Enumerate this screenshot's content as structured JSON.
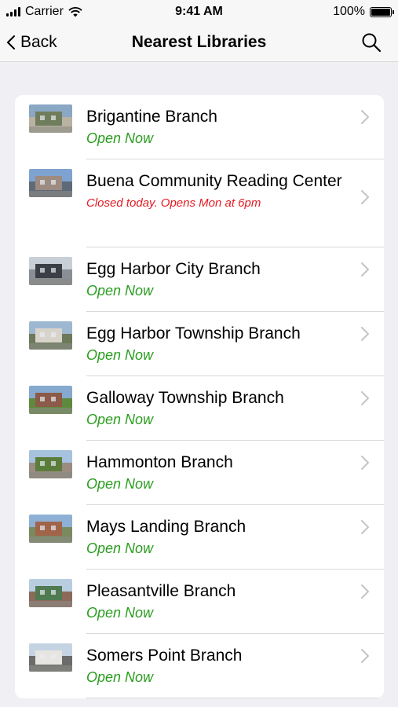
{
  "status_bar": {
    "carrier": "Carrier",
    "time": "9:41 AM",
    "battery": "100%"
  },
  "nav": {
    "back_label": "Back",
    "title": "Nearest Libraries"
  },
  "libraries": [
    {
      "name": "Brigantine Branch",
      "status": "Open Now",
      "open": true
    },
    {
      "name": "Buena Community Reading Center",
      "status": "Closed today. Opens Mon at 6pm",
      "open": false
    },
    {
      "name": "Egg Harbor City Branch",
      "status": "Open Now",
      "open": true
    },
    {
      "name": "Egg Harbor Township Branch",
      "status": "Open Now",
      "open": true
    },
    {
      "name": "Galloway Township Branch",
      "status": "Open Now",
      "open": true
    },
    {
      "name": "Hammonton Branch",
      "status": "Open Now",
      "open": true
    },
    {
      "name": "Mays Landing Branch",
      "status": "Open Now",
      "open": true
    },
    {
      "name": "Pleasantville Branch",
      "status": "Open Now",
      "open": true
    },
    {
      "name": "Somers Point Branch",
      "status": "Open Now",
      "open": true
    }
  ],
  "colors": {
    "open": "#2a9d1f",
    "closed": "#e31b23"
  }
}
